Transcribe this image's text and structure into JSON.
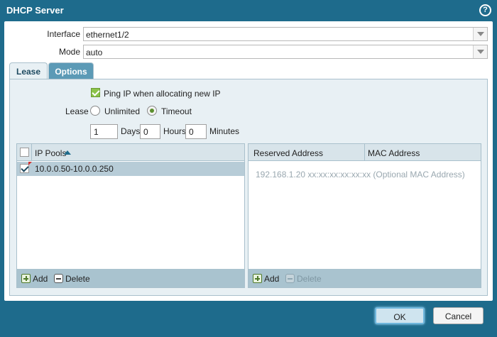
{
  "dialog": {
    "title": "DHCP Server",
    "help_icon": "?"
  },
  "form": {
    "interface_label": "Interface",
    "interface_value": "ethernet1/2",
    "mode_label": "Mode",
    "mode_value": "auto"
  },
  "tabs": [
    {
      "label": "Lease",
      "active": true
    },
    {
      "label": "Options",
      "active": false
    }
  ],
  "lease": {
    "ping_label": "Ping IP when allocating new IP",
    "ping_checked": true,
    "lease_label": "Lease",
    "unlimited_label": "Unlimited",
    "timeout_label": "Timeout",
    "selected": "Timeout",
    "days_value": "1",
    "days_label": "Days",
    "hours_value": "0",
    "hours_label": "Hours",
    "minutes_value": "0",
    "minutes_label": "Minutes"
  },
  "ip_pools": {
    "header": "IP Pools",
    "rows": [
      {
        "value": "10.0.0.50-10.0.0.250",
        "checked": true
      }
    ],
    "add_label": "Add",
    "delete_label": "Delete"
  },
  "reserved": {
    "col_address": "Reserved Address",
    "col_mac": "MAC Address",
    "placeholder": "192.168.1.20 xx:xx:xx:xx:xx:xx (Optional MAC Address)",
    "add_label": "Add",
    "delete_label": "Delete"
  },
  "footer": {
    "ok_label": "OK",
    "cancel_label": "Cancel"
  },
  "colors": {
    "titlebar": "#1e6b8c",
    "panel": "#e8f0f4",
    "selected_row": "#b7ccd7",
    "footer_bar": "#a9c3cf"
  }
}
